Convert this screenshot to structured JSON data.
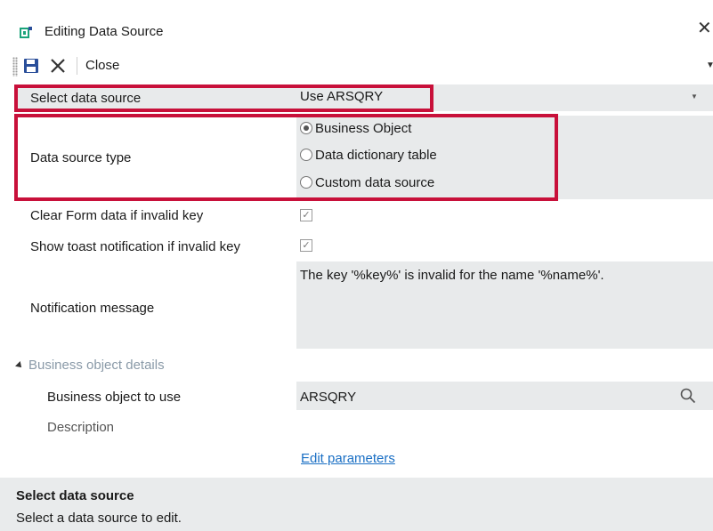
{
  "window": {
    "title": "Editing Data Source",
    "close_glyph": "✕"
  },
  "toolbar": {
    "save_icon": "save-icon",
    "cancel_icon": "close-icon",
    "close_label": "Close"
  },
  "form": {
    "select_data_source": {
      "label": "Select data source",
      "value": "Use ARSQRY"
    },
    "data_source_type": {
      "label": "Data source type",
      "options": [
        "Business Object",
        "Data dictionary table",
        "Custom data source"
      ],
      "selected": "Business Object"
    },
    "clear_form": {
      "label": "Clear Form data if invalid key",
      "checked": true
    },
    "show_toast": {
      "label": "Show toast notification if invalid key",
      "checked": true
    },
    "notification": {
      "label": "Notification message",
      "value": "The key '%key%' is invalid for the name '%name%'."
    },
    "business_object_details": {
      "section_label": "Business object details",
      "bo_to_use_label": "Business object to use",
      "bo_to_use_value": "ARSQRY",
      "description_label": "Description",
      "edit_parameters_label": "Edit parameters"
    }
  },
  "footer": {
    "title": "Select data source",
    "description": "Select a data source to edit."
  },
  "colors": {
    "highlight_border": "#c8103a",
    "field_bg": "#e8eaeb",
    "link": "#1a6fc4",
    "accent_green": "#1aa37a",
    "save_blue": "#2b4f9a"
  }
}
